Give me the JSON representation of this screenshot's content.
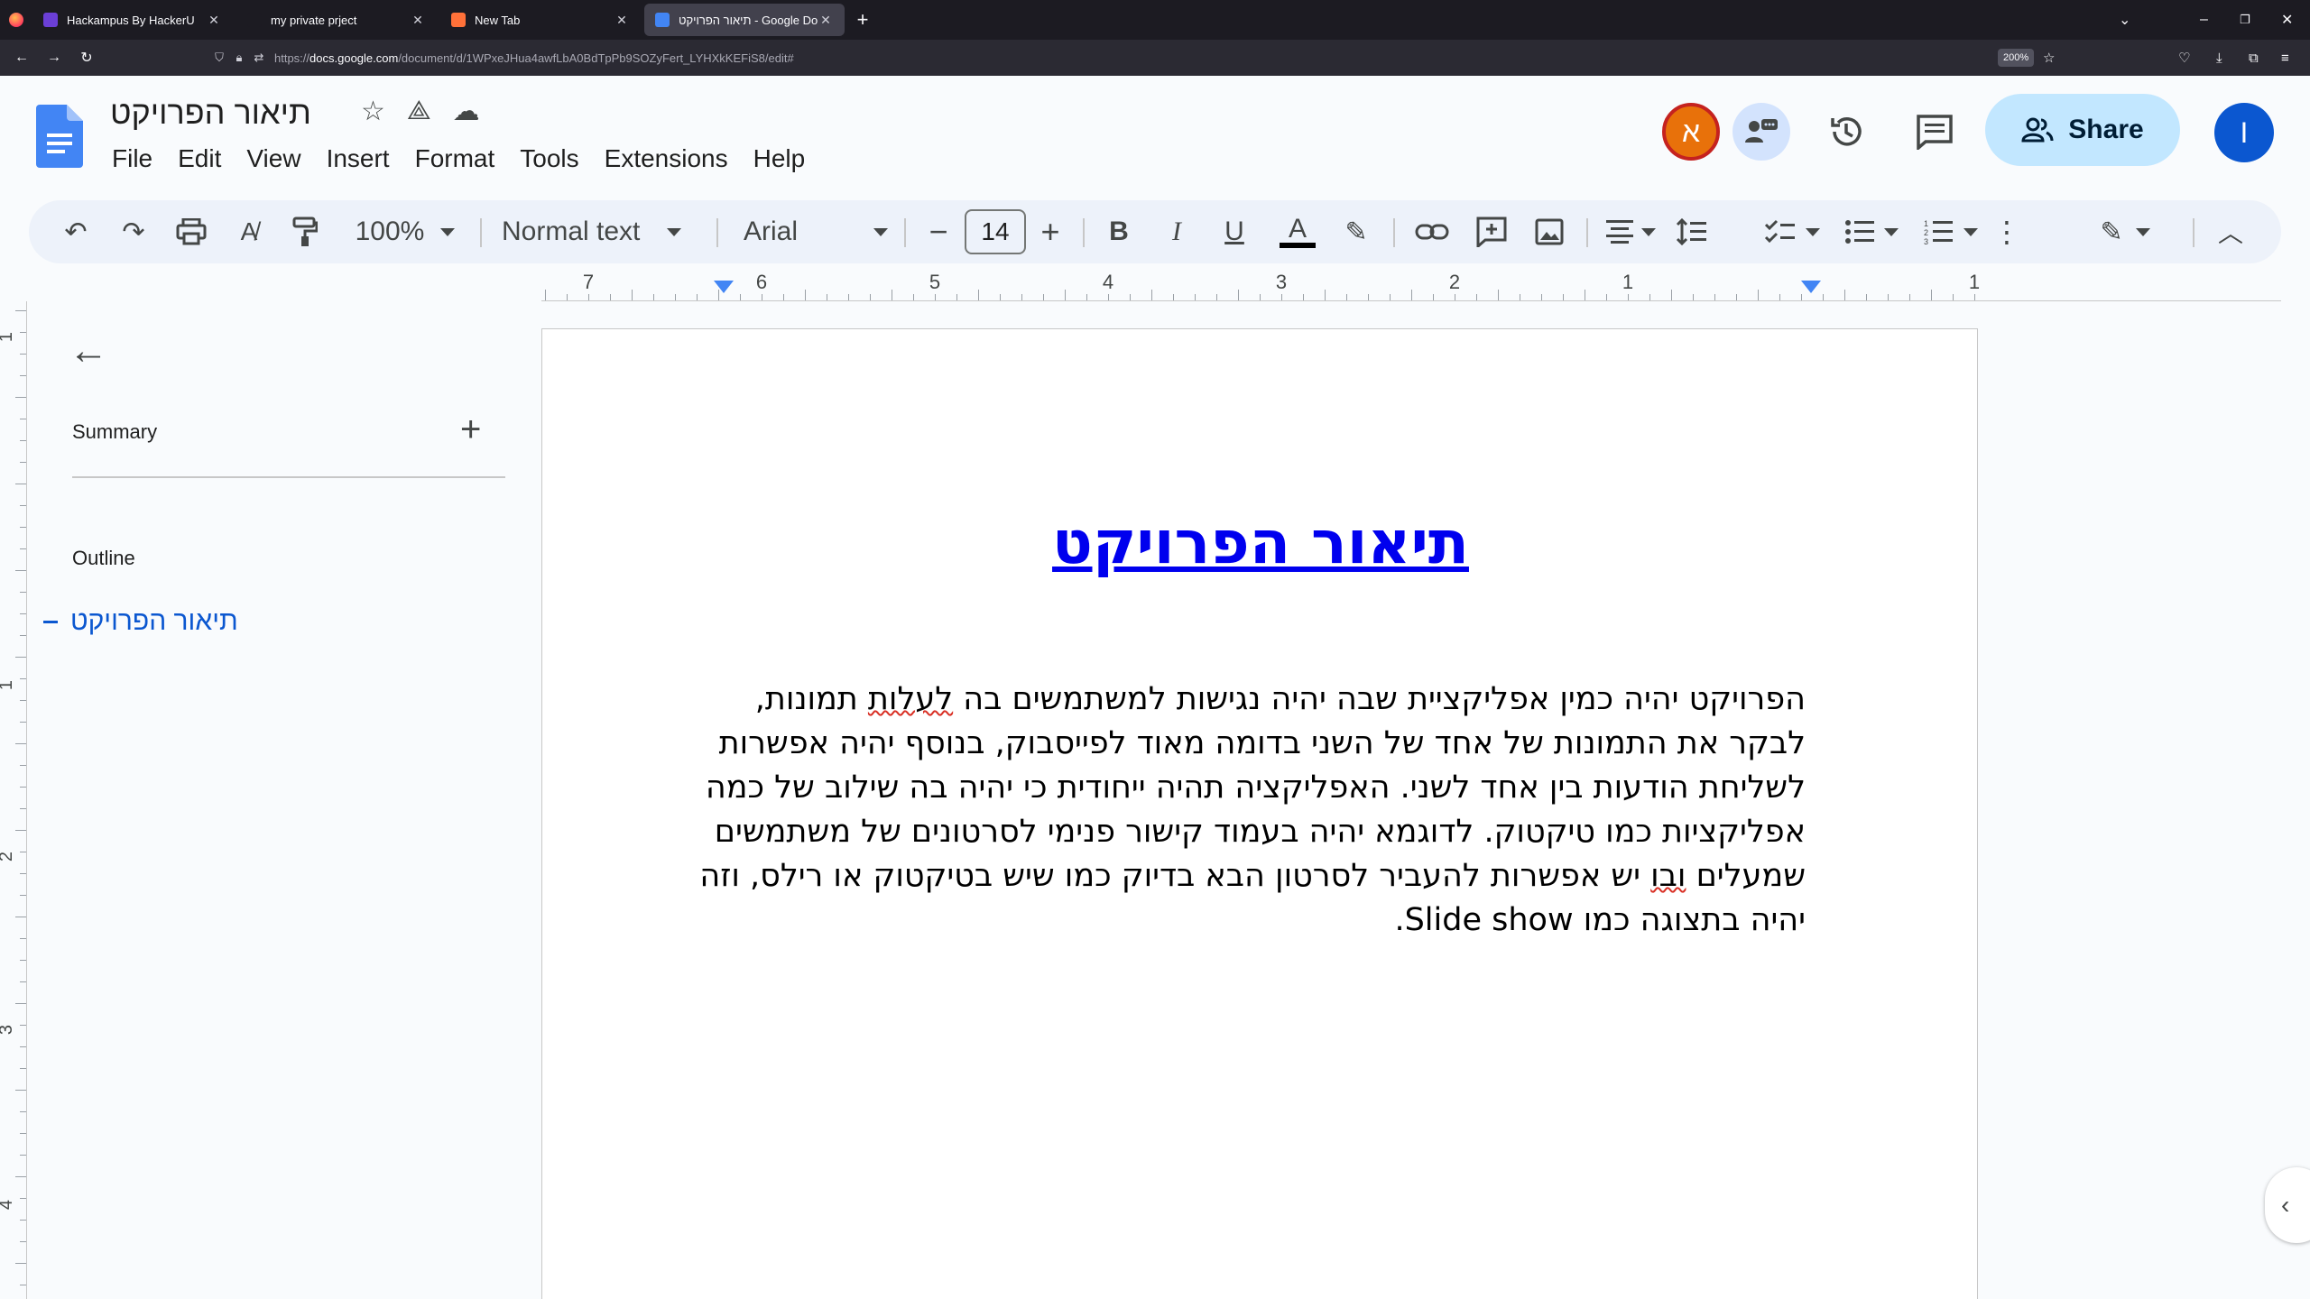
{
  "browser": {
    "tabs": [
      {
        "title": "Hackampus By HackerU",
        "favicon_color": "#6b3fd6",
        "active": false
      },
      {
        "title": "my private prject",
        "favicon_color": "#1c1b22",
        "active": false
      },
      {
        "title": "New Tab",
        "favicon_color": "#ff7139",
        "active": false
      },
      {
        "title": "תיאור הפרויקט - Google Docs",
        "favicon_color": "#4285f4",
        "active": true
      }
    ],
    "url_prefix": "https://",
    "url_domain": "docs.google.com",
    "url_path": "/document/d/1WPxeJHua4awfLbA0BdTpPb9SOZyFert_LYHXkKEFiS8/edit#",
    "zoom_badge": "200%"
  },
  "docs": {
    "title": "תיאור הפרויקט",
    "menu": [
      "File",
      "Edit",
      "View",
      "Insert",
      "Format",
      "Tools",
      "Extensions",
      "Help"
    ],
    "collaborator_initial": "א",
    "share_label": "Share",
    "user_initial": "I",
    "toolbar": {
      "zoom": "100%",
      "style": "Normal text",
      "font": "Arial",
      "font_size": "14"
    },
    "ruler_numbers": [
      "7",
      "6",
      "5",
      "4",
      "3",
      "2",
      "1",
      "1"
    ],
    "vruler_numbers": [
      "1",
      "1",
      "2",
      "3",
      "4"
    ],
    "side_panel": {
      "summary_label": "Summary",
      "outline_label": "Outline",
      "outline_items": [
        "תיאור הפרויקט"
      ]
    },
    "document": {
      "heading": "תיאור הפרויקט",
      "body_lines": [
        {
          "pre": "הפרויקט יהיה כמין אפליקציית שבה יהיה נגישות למשתמשים בה ",
          "squiggle": "לעלות",
          "post": " תמונות,"
        },
        {
          "pre": "לבקר את התמונות של אחד של השני בדומה מאוד לפייסבוק, בנוסף יהיה אפשרות",
          "squiggle": "",
          "post": ""
        },
        {
          "pre": "לשליחת הודעות בין אחד לשני. האפליקציה תהיה ייחודית כי יהיה בה שילוב של כמה",
          "squiggle": "",
          "post": ""
        },
        {
          "pre": "אפליקציות כמו טיקטוק. לדוגמא יהיה בעמוד קישור פנימי לסרטונים של משתמשים",
          "squiggle": "",
          "post": ""
        },
        {
          "pre": "שמעלים ",
          "squiggle": "ובו",
          "post": " יש אפשרות להעביר לסרטון הבא בדיוק כמו שיש בטיקטוק או רילס, וזה"
        },
        {
          "pre": "יהיה בתצוגה כמו Slide show.",
          "squiggle": "",
          "post": ""
        }
      ]
    }
  }
}
